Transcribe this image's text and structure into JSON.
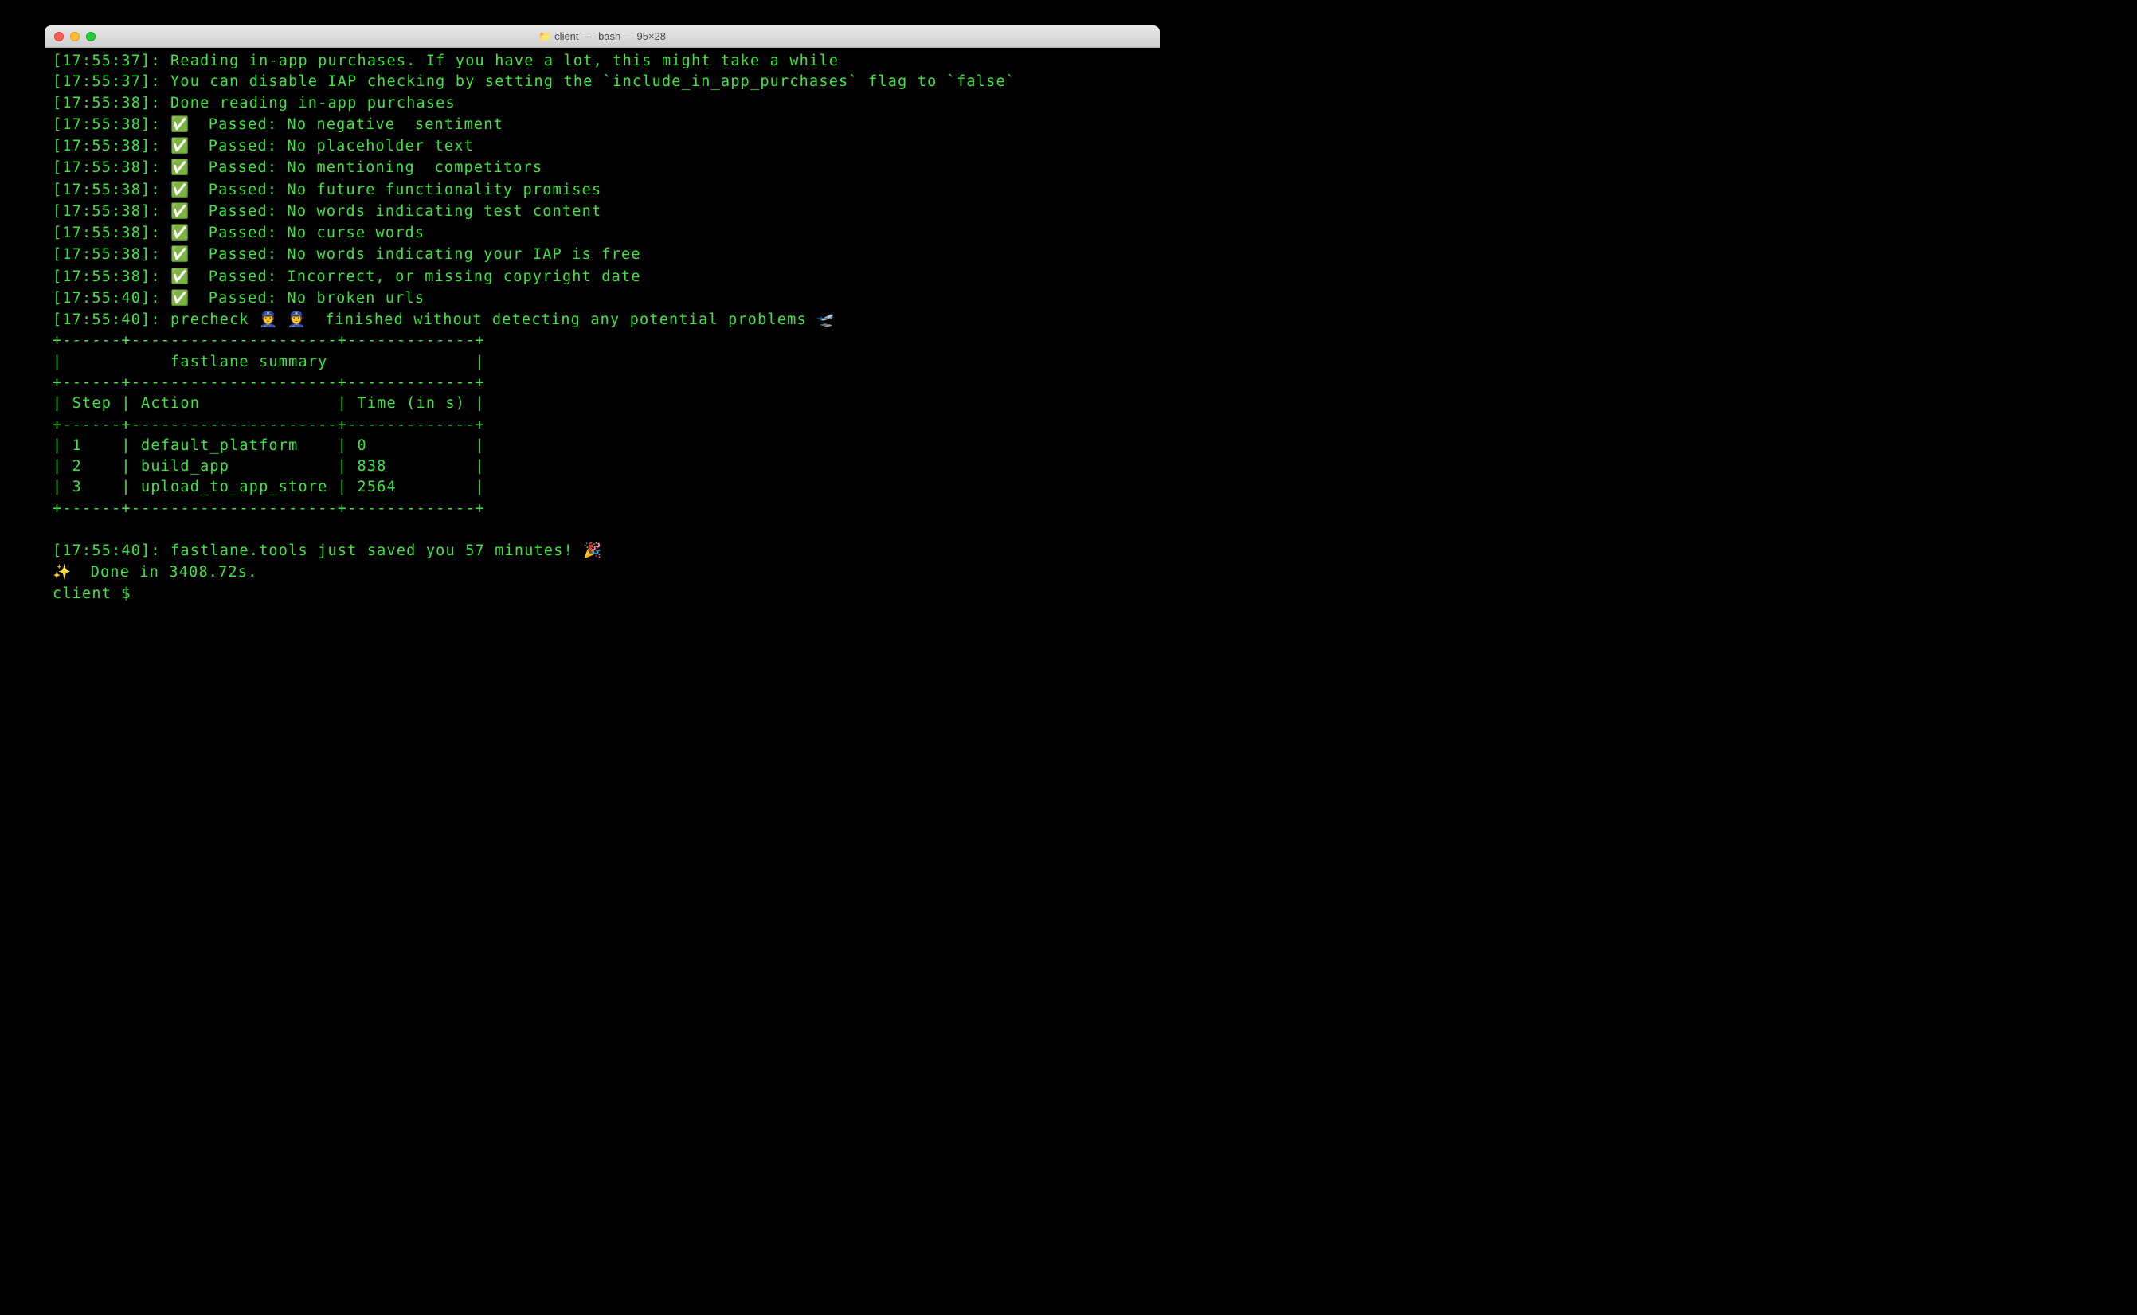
{
  "window": {
    "title": "client — -bash — 95×28",
    "folder_icon": "📁"
  },
  "log": {
    "l1": "[17:55:37]: Reading in-app purchases. If you have a lot, this might take a while",
    "l2": "[17:55:37]: You can disable IAP checking by setting the `include_in_app_purchases` flag to `false`",
    "l3": "[17:55:38]: Done reading in-app purchases",
    "l4_ts": "[17:55:38]: ",
    "l4_rest": "  Passed: No negative  sentiment",
    "l5_ts": "[17:55:38]: ",
    "l5_rest": "  Passed: No placeholder text",
    "l6_ts": "[17:55:38]: ",
    "l6_rest": "  Passed: No mentioning  competitors",
    "l7_ts": "[17:55:38]: ",
    "l7_rest": "  Passed: No future functionality promises",
    "l8_ts": "[17:55:38]: ",
    "l8_rest": "  Passed: No words indicating test content",
    "l9_ts": "[17:55:38]: ",
    "l9_rest": "  Passed: No curse words",
    "l10_ts": "[17:55:38]: ",
    "l10_rest": "  Passed: No words indicating your IAP is free",
    "l11_ts": "[17:55:38]: ",
    "l11_rest": "  Passed: Incorrect, or missing copyright date",
    "l12_ts": "[17:55:40]: ",
    "l12_rest": "  Passed: No broken urls",
    "l13_ts": "[17:55:40]: precheck ",
    "l13_rest": "  finished without detecting any potential problems ",
    "check": "✅",
    "cop": "👮",
    "plane": "🛫",
    "party": "🎉",
    "sparkle": "✨",
    "blank": "",
    "t1": "+------+---------------------+-------------+",
    "t2": "|           fastlane summary               |",
    "t3": "+------+---------------------+-------------+",
    "t4": "| Step | Action              | Time (in s) |",
    "t5": "+------+---------------------+-------------+",
    "t6": "| 1    | default_platform    | 0           |",
    "t7": "| 2    | build_app           | 838         |",
    "t8": "| 3    | upload_to_app_store | 2564        |",
    "t9": "+------+---------------------+-------------+",
    "saved_ts": "[17:55:40]: fastlane.tools just saved you 57 minutes! ",
    "done": "  Done in 3408.72s.",
    "prompt": "client $ "
  }
}
